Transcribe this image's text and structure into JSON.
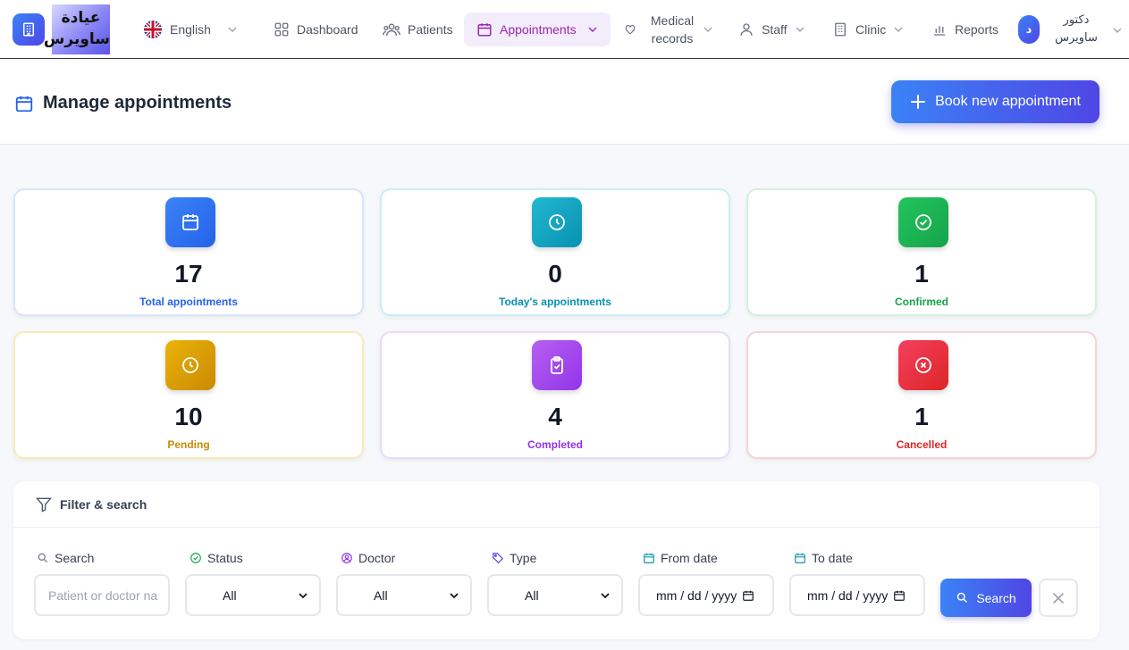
{
  "brand": {
    "name": "عيادة ساويرس"
  },
  "nav": {
    "language": "English",
    "items": [
      {
        "label": "Dashboard"
      },
      {
        "label": "Patients"
      },
      {
        "label": "Appointments"
      },
      {
        "label": "Medical records"
      },
      {
        "label": "Staff"
      },
      {
        "label": "Clinic"
      },
      {
        "label": "Reports"
      }
    ],
    "active": "Appointments",
    "user": {
      "initial": "د",
      "name": "دكتور ساويرس"
    }
  },
  "header": {
    "title": "Manage appointments",
    "book_button": "Book new appointment"
  },
  "stats": [
    {
      "value": "17",
      "label": "Total appointments",
      "color": "#2563eb",
      "icon": "calendar-icon"
    },
    {
      "value": "0",
      "label": "Today's appointments",
      "color": "#0891b2",
      "icon": "clock-icon"
    },
    {
      "value": "1",
      "label": "Confirmed",
      "color": "#16a34a",
      "icon": "check-circle-icon"
    },
    {
      "value": "10",
      "label": "Pending",
      "color": "#ca8a04",
      "icon": "clock-icon"
    },
    {
      "value": "4",
      "label": "Completed",
      "color": "#9333ea",
      "icon": "clipboard-check-icon"
    },
    {
      "value": "1",
      "label": "Cancelled",
      "color": "#dc2626",
      "icon": "x-circle-icon"
    }
  ],
  "filter": {
    "title": "Filter & search",
    "search_label": "Search",
    "search_placeholder": "Patient or doctor na",
    "status_label": "Status",
    "status_value": "All",
    "doctor_label": "Doctor",
    "doctor_value": "All",
    "type_label": "Type",
    "type_value": "All",
    "from_label": "From date",
    "from_placeholder": "mm / dd / yyyy",
    "to_label": "To date",
    "to_placeholder": "mm / dd / yyyy",
    "search_button": "Search"
  }
}
